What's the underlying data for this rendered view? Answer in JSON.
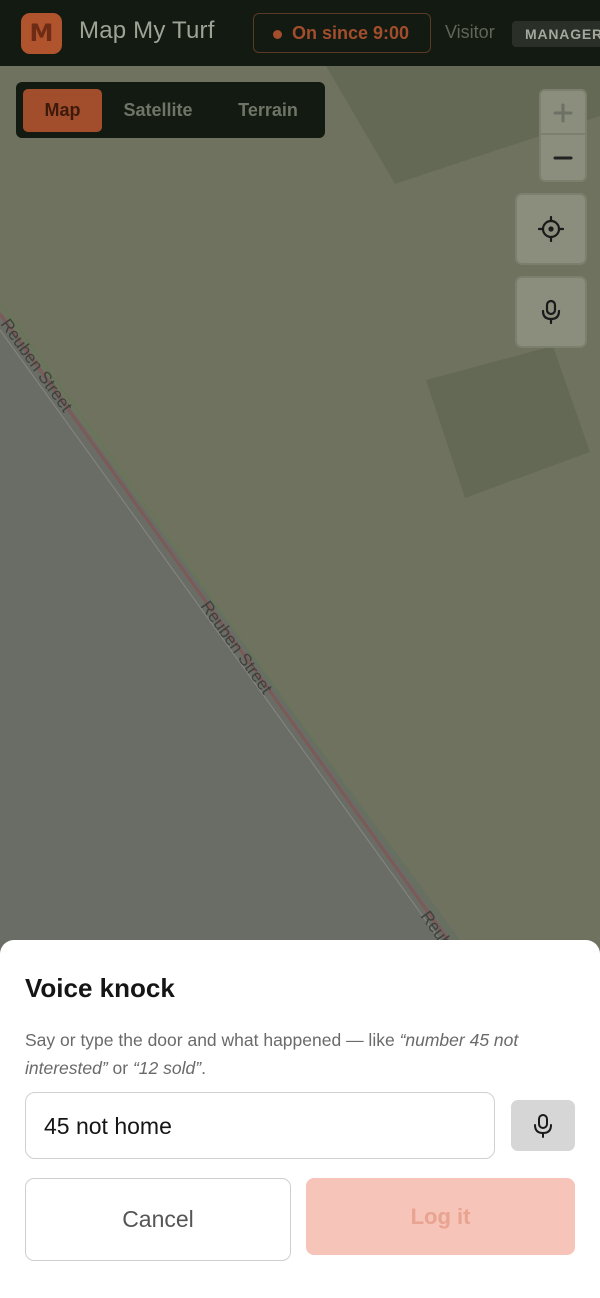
{
  "header": {
    "logo_letter": "M",
    "app_title": "Map My Turf",
    "status_text": "On since 9:00",
    "visitor_label": "Visitor",
    "role_badge": "MANAGER"
  },
  "map": {
    "layer_tabs": [
      {
        "label": "Map",
        "active": true
      },
      {
        "label": "Satellite",
        "active": false
      },
      {
        "label": "Terrain",
        "active": false
      }
    ],
    "street_labels": [
      "Reuben Street",
      "Reuben Street",
      "Reuben Street"
    ],
    "controls": {
      "zoom_in_icon": "plus-icon",
      "zoom_out_icon": "minus-icon",
      "locate_icon": "crosshair-icon",
      "voice_icon": "microphone-icon"
    }
  },
  "sheet": {
    "title": "Voice knock",
    "desc_prefix": "Say or type the door and what happened — like ",
    "desc_example1": "“number 45 not interested”",
    "desc_middle": " or ",
    "desc_example2": "“12 sold”",
    "desc_suffix": ".",
    "input_value": "45 not home",
    "cancel_label": "Cancel",
    "submit_label": "Log it"
  },
  "colors": {
    "accent": "#b0542d",
    "header_bg": "#131a12",
    "map_bg": "#6f725f",
    "submit_disabled_bg": "#f6c4b8"
  }
}
